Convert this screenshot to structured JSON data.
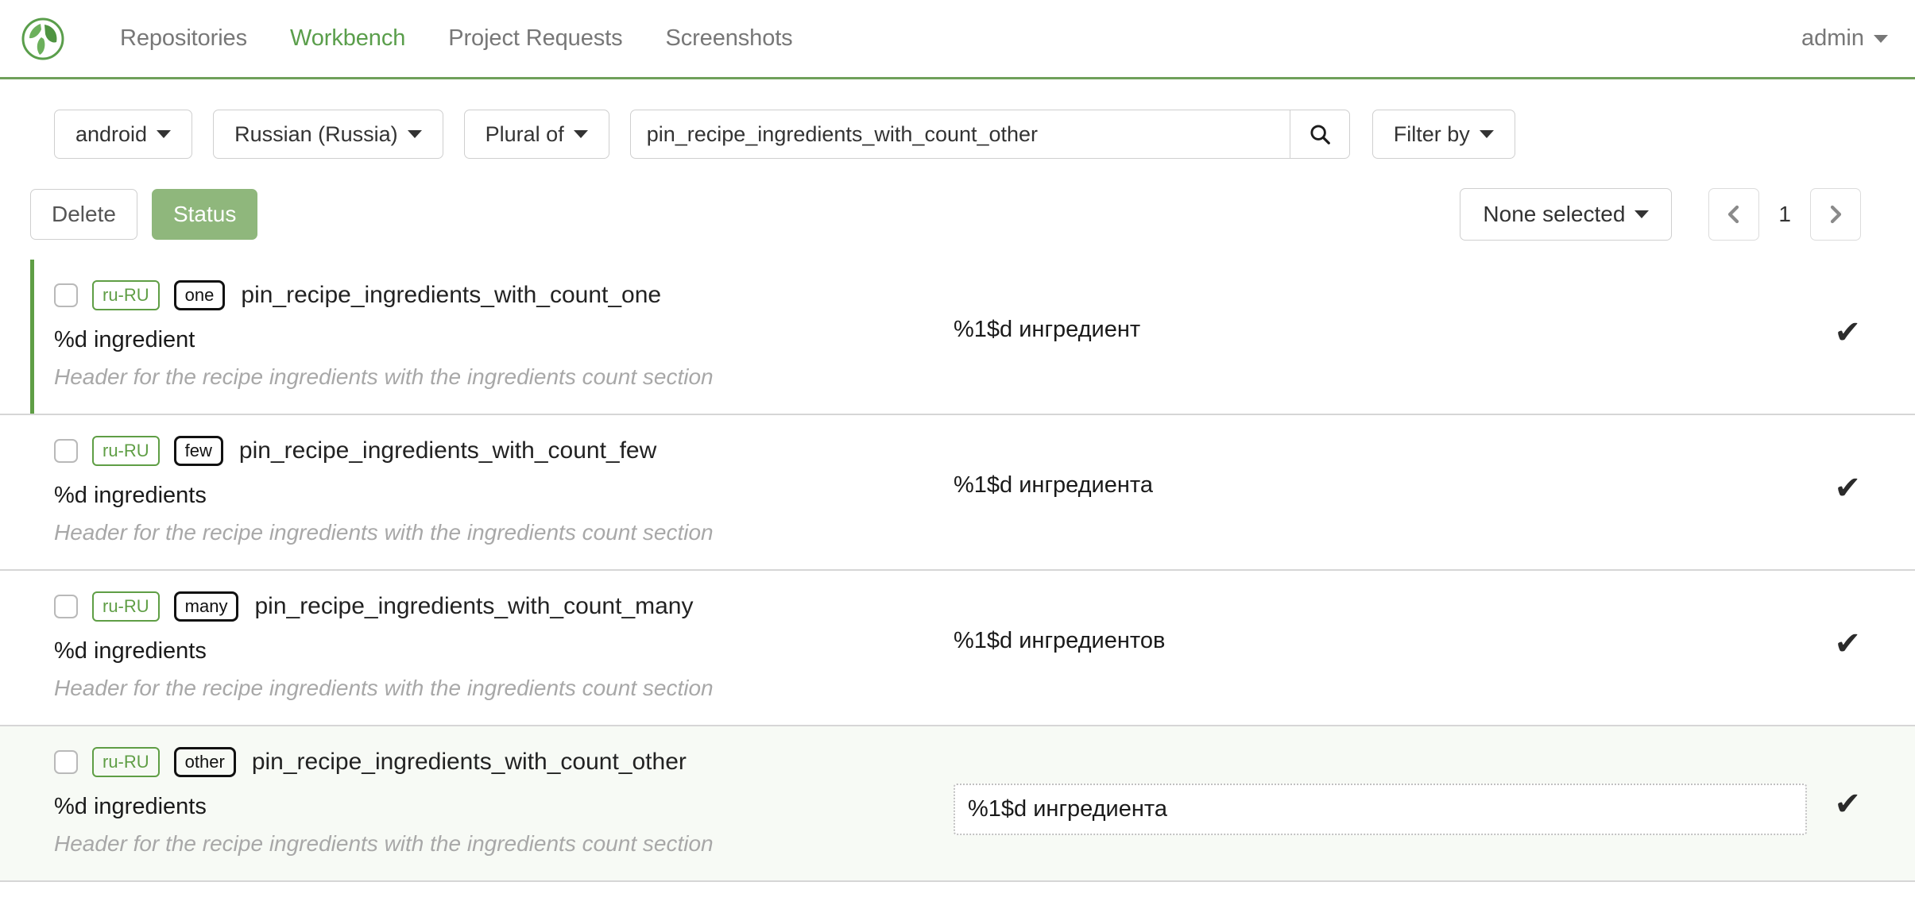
{
  "nav": {
    "logo_icon": "leaf-globe-logo",
    "links": [
      {
        "label": "Repositories",
        "active": false
      },
      {
        "label": "Workbench",
        "active": true
      },
      {
        "label": "Project Requests",
        "active": false
      },
      {
        "label": "Screenshots",
        "active": false
      }
    ],
    "user": "admin",
    "accent_color": "#6FA05A"
  },
  "filter_bar": {
    "project": "android",
    "locale": "Russian (Russia)",
    "search_type": "Plural of",
    "search_value": "pin_recipe_ingredients_with_count_other",
    "search_placeholder": "",
    "search_icon": "search-icon",
    "filter_by": "Filter by"
  },
  "toolbar": {
    "delete_label": "Delete",
    "status_label": "Status",
    "status_color": "#8FB77C",
    "selection_label": "None selected",
    "prev_icon": "chevron-left-icon",
    "next_icon": "chevron-right-icon",
    "page_number": "1"
  },
  "rows": [
    {
      "locale": "ru-RU",
      "plural": "one",
      "key": "pin_recipe_ingredients_with_count_one",
      "source": "%d ingredient",
      "comment": "Header for the recipe ingredients with the ingredients count section",
      "target": "%1$d ингредиент",
      "checkmark": "✔",
      "editing": false,
      "accented": true,
      "active": false
    },
    {
      "locale": "ru-RU",
      "plural": "few",
      "key": "pin_recipe_ingredients_with_count_few",
      "source": "%d ingredients",
      "comment": "Header for the recipe ingredients with the ingredients count section",
      "target": "%1$d ингредиента",
      "checkmark": "✔",
      "editing": false,
      "accented": false,
      "active": false
    },
    {
      "locale": "ru-RU",
      "plural": "many",
      "key": "pin_recipe_ingredients_with_count_many",
      "source": "%d ingredients",
      "comment": "Header for the recipe ingredients with the ingredients count section",
      "target": "%1$d ингредиентов",
      "checkmark": "✔",
      "editing": false,
      "accented": false,
      "active": false
    },
    {
      "locale": "ru-RU",
      "plural": "other",
      "key": "pin_recipe_ingredients_with_count_other",
      "source": "%d ingredients",
      "comment": "Header for the recipe ingredients with the ingredients count section",
      "target": "%1$d ингредиента",
      "checkmark": "✔",
      "editing": true,
      "accented": false,
      "active": true
    }
  ]
}
